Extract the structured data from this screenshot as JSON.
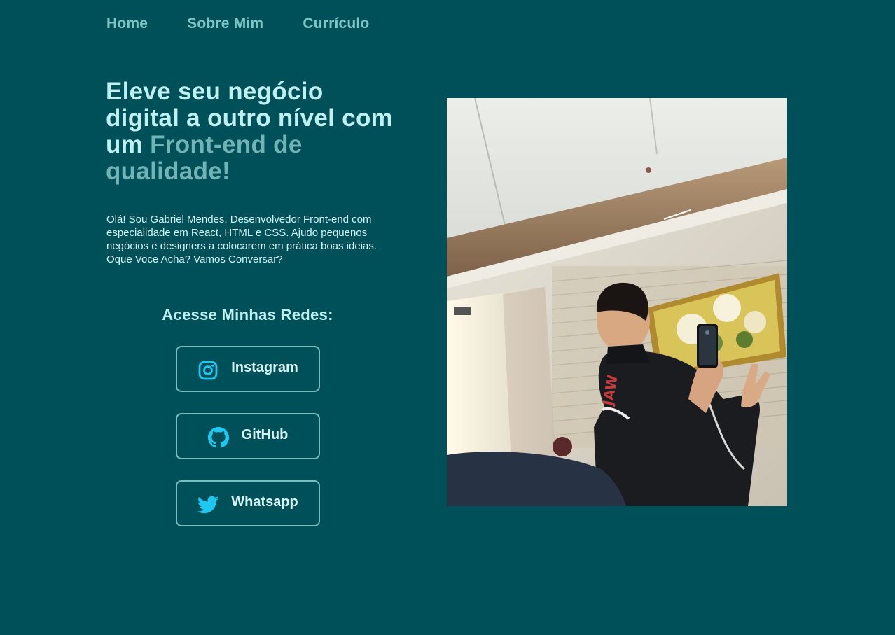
{
  "nav": {
    "items": [
      {
        "label": "Home"
      },
      {
        "label": "Sobre Mim"
      },
      {
        "label": "Currículo"
      }
    ]
  },
  "hero": {
    "title_part1": "Eleve seu negócio digital a outro nível com um ",
    "title_accent": "Front-end de qualidade!",
    "intro": "Olá! Sou Gabriel Mendes, Desenvolvedor Front-end com especialidade em React, HTML e CSS. Ajudo pequenos negócios e designers a colocarem em prática boas ideias. Oque Voce Acha? Vamos Conversar?"
  },
  "socials": {
    "title": "Acesse Minhas Redes:",
    "buttons": [
      {
        "label": "Instagram",
        "icon": "instagram-icon"
      },
      {
        "label": "GitHub",
        "icon": "github-icon"
      },
      {
        "label": "Whatsapp",
        "icon": "twitter-bird-icon"
      }
    ]
  },
  "photo": {
    "description": "profile-photo"
  },
  "colors": {
    "background": "#005059",
    "title": "#bff0f2",
    "accent": "#72b3b6",
    "nav": "#7fc4c7",
    "icon": "#1ec8f0",
    "border": "#78bcc0"
  }
}
